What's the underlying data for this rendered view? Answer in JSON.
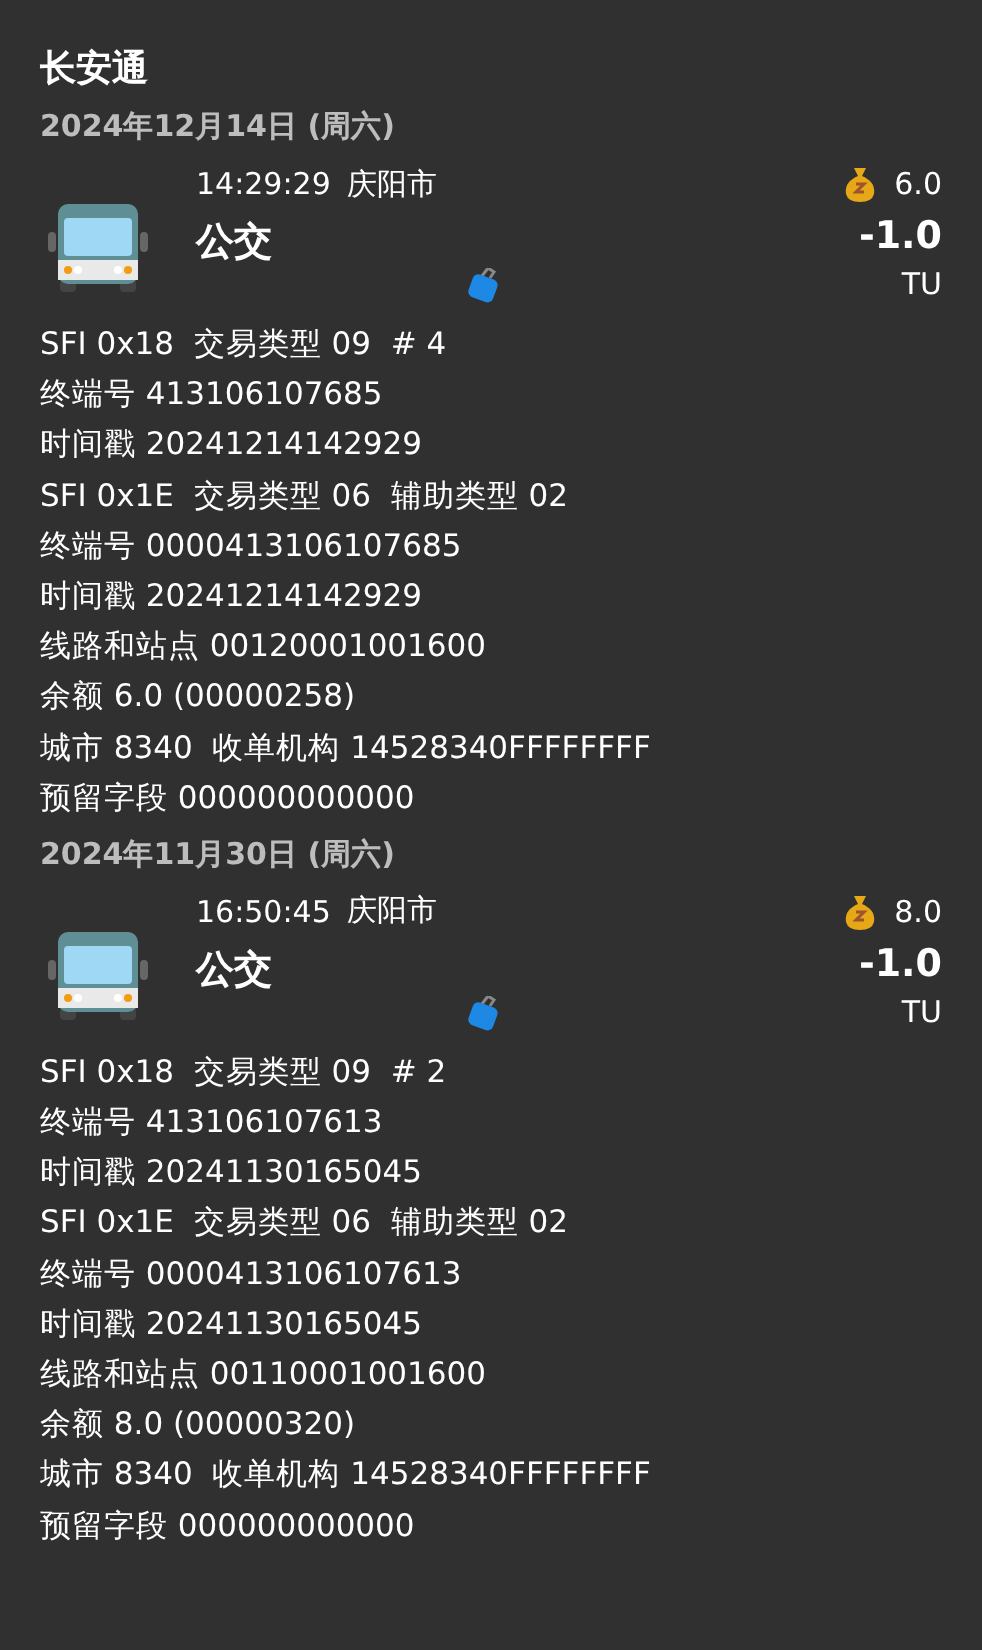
{
  "title": "长安通",
  "groups": [
    {
      "date": "2024年12月14日 (周六)",
      "time": "14:29:29",
      "city": "庆阳市",
      "type": "公交",
      "balance": "6.0",
      "amount": "-1.0",
      "unit": "TU",
      "details": [
        "SFI 0x18  交易类型 09  # 4",
        "终端号 413106107685",
        "时间戳 20241214142929",
        "SFI 0x1E  交易类型 06  辅助类型 02",
        "终端号 0000413106107685",
        "时间戳 20241214142929",
        "线路和站点 00120001001600",
        "余额 6.0 (00000258)",
        "城市 8340  收单机构 14528340FFFFFFFF",
        "预留字段 000000000000"
      ]
    },
    {
      "date": "2024年11月30日 (周六)",
      "time": "16:50:45",
      "city": "庆阳市",
      "type": "公交",
      "balance": "8.0",
      "amount": "-1.0",
      "unit": "TU",
      "details": [
        "SFI 0x18  交易类型 09  # 2",
        "终端号 413106107613",
        "时间戳 20241130165045",
        "SFI 0x1E  交易类型 06  辅助类型 02",
        "终端号 0000413106107613",
        "时间戳 20241130165045",
        "线路和站点 00110001001600",
        "余额 8.0 (00000320)",
        "城市 8340  收单机构 14528340FFFFFFFF",
        "预留字段 000000000000"
      ]
    }
  ]
}
